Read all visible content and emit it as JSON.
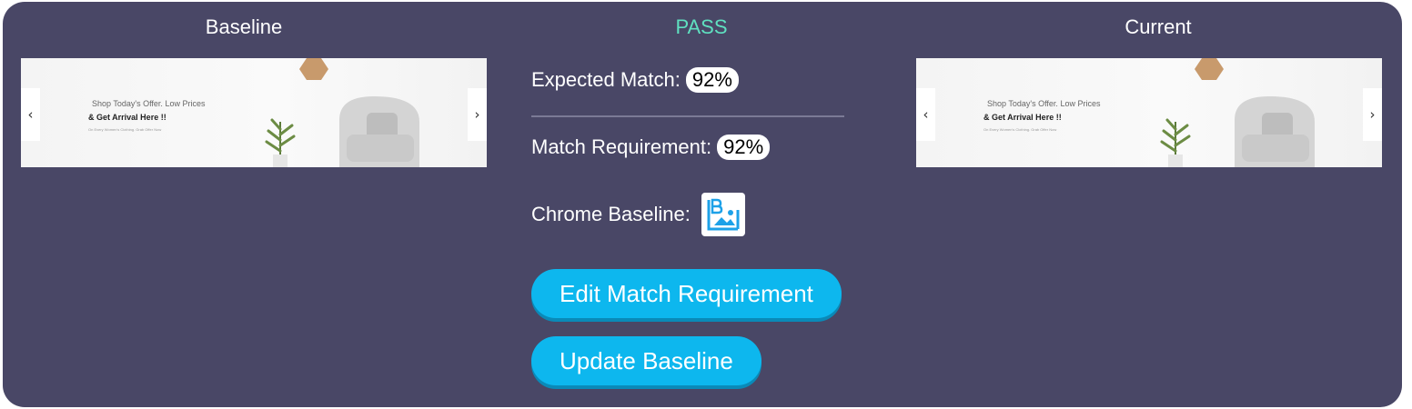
{
  "columns": {
    "baseline_title": "Baseline",
    "status": "PASS",
    "current_title": "Current"
  },
  "colors": {
    "panel_bg": "#494766",
    "status_pass": "#5fe0c0",
    "button_bg": "#0db7ee",
    "pill_bg": "#ffffff"
  },
  "screenshot": {
    "line1": "Shop Today's Offer. Low Prices",
    "line2": "& Get Arrival Here !!",
    "line3": "On Every Women's Clothing. Grab Offer Now",
    "prev_icon": "chevron-left-icon",
    "next_icon": "chevron-right-icon"
  },
  "details": {
    "expected_match_label": "Expected Match:",
    "expected_match_value": "92%",
    "match_requirement_label": "Match Requirement:",
    "match_requirement_value": "92%",
    "chrome_baseline_label": "Chrome Baseline:",
    "chrome_baseline_icon": "baseline-image-icon"
  },
  "actions": {
    "edit_match_requirement": "Edit Match Requirement",
    "update_baseline": "Update Baseline"
  }
}
